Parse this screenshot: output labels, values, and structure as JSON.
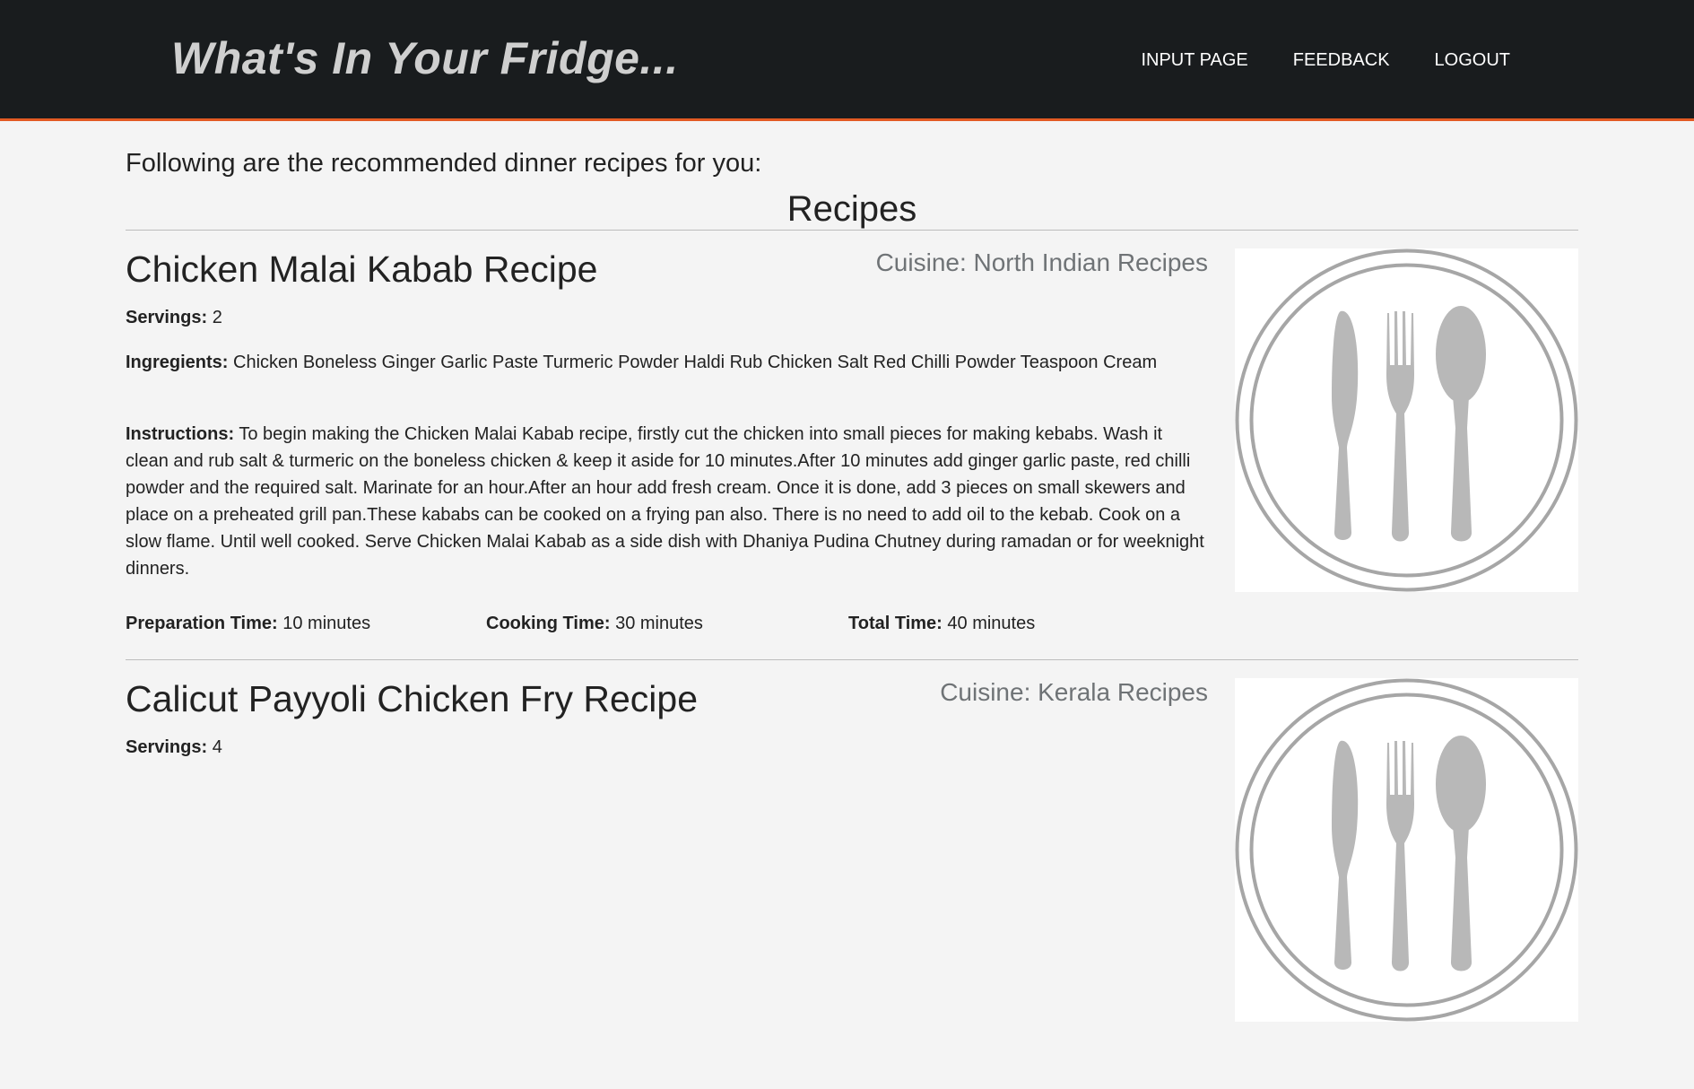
{
  "header": {
    "brand": "What's In Your Fridge...",
    "nav": [
      "INPUT PAGE",
      "FEEDBACK",
      "LOGOUT"
    ]
  },
  "page": {
    "intro": "Following are the recommended dinner recipes for you:",
    "section_title": "Recipes"
  },
  "labels": {
    "servings": "Servings:",
    "ingredients": "Ingregients:",
    "instructions": "Instructions:",
    "prep_time": "Preparation Time:",
    "cook_time": "Cooking Time:",
    "total_time": "Total Time:"
  },
  "recipes": [
    {
      "title": "Chicken Malai Kabab Recipe",
      "cuisine": "Cuisine: North Indian Recipes",
      "servings": "2",
      "ingredients": "Chicken Boneless Ginger Garlic Paste Turmeric Powder Haldi Rub Chicken Salt Red Chilli Powder Teaspoon Cream",
      "instructions": "To begin making the Chicken Malai Kabab recipe, firstly cut the chicken into small pieces for making kebabs. Wash it clean and rub salt & turmeric on the boneless chicken & keep it aside for 10 minutes.After 10 minutes add ginger garlic paste, red chilli powder and the required salt. Marinate for an hour.After an hour add fresh cream. Once it is done, add 3 pieces on small skewers and place on a preheated grill pan.These kababs can be cooked on a frying pan also. There is no need to add oil to the kebab. Cook on a slow flame. Until well cooked. Serve Chicken Malai Kabab as a side dish with Dhaniya Pudina Chutney during ramadan or for weeknight dinners.",
      "prep_time": "10 minutes",
      "cook_time": "30 minutes",
      "total_time": "40 minutes"
    },
    {
      "title": "Calicut Payyoli Chicken Fry Recipe",
      "cuisine": "Cuisine: Kerala Recipes",
      "servings": "4"
    }
  ],
  "icons": {
    "recipe_image": "plate-cutlery-icon"
  },
  "colors": {
    "header_bg": "#191c1e",
    "accent": "#e25a23",
    "brand_text": "#cfcfcf",
    "page_bg": "#f4f4f4",
    "cuisine_text": "#6f7376",
    "icon_gray": "#a6a6a6"
  }
}
